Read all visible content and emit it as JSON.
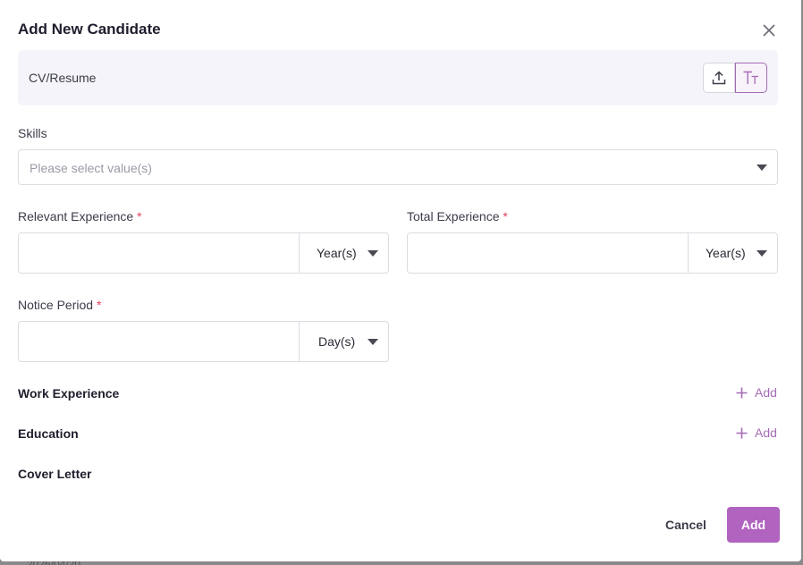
{
  "background": {
    "date_text": "2026/04/20"
  },
  "dialog": {
    "title": "Add New Candidate",
    "cv": {
      "label": "CV/Resume"
    },
    "skills": {
      "label": "Skills",
      "placeholder": "Please select value(s)"
    },
    "relevant_experience": {
      "label": "Relevant Experience",
      "required": "*",
      "value": "",
      "unit": "Year(s)"
    },
    "total_experience": {
      "label": "Total Experience",
      "required": "*",
      "value": "",
      "unit": "Year(s)"
    },
    "notice_period": {
      "label": "Notice Period",
      "required": "*",
      "value": "",
      "unit": "Day(s)"
    },
    "work_experience": {
      "label": "Work Experience",
      "add_label": "Add"
    },
    "education": {
      "label": "Education",
      "add_label": "Add"
    },
    "cover_letter": {
      "label": "Cover Letter"
    },
    "footer": {
      "cancel_label": "Cancel",
      "add_label": "Add"
    }
  },
  "colors": {
    "accent": "#b063bf",
    "required": "#e0405a"
  }
}
